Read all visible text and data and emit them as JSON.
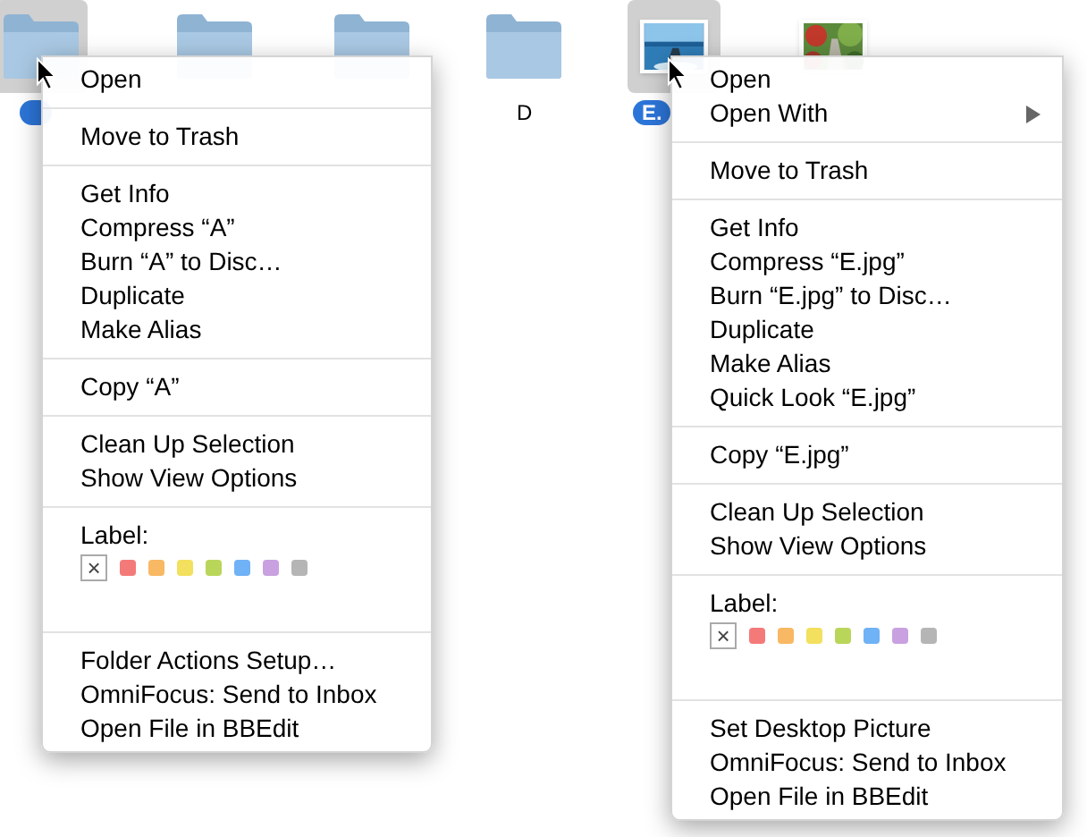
{
  "icons": [
    {
      "kind": "folder",
      "selected": true
    },
    {
      "kind": "folder",
      "selected": false
    },
    {
      "kind": "folder",
      "selected": false
    },
    {
      "kind": "folder",
      "selected": false,
      "label": "D"
    },
    {
      "kind": "picture",
      "selected": true,
      "label": "E."
    },
    {
      "kind": "picture",
      "selected": false
    }
  ],
  "menus": [
    {
      "sections": [
        [
          {
            "kind": "item",
            "text": "Open"
          }
        ],
        [
          {
            "kind": "item",
            "text": "Move to Trash"
          }
        ],
        [
          {
            "kind": "item",
            "text": "Get Info"
          },
          {
            "kind": "item",
            "text": "Compress “A”"
          },
          {
            "kind": "item",
            "text": "Burn “A” to Disc…"
          },
          {
            "kind": "item",
            "text": "Duplicate"
          },
          {
            "kind": "item",
            "text": "Make Alias"
          }
        ],
        [
          {
            "kind": "item",
            "text": "Copy “A”"
          }
        ],
        [
          {
            "kind": "item",
            "text": "Clean Up Selection"
          },
          {
            "kind": "item",
            "text": "Show View Options"
          }
        ],
        [
          {
            "kind": "labels",
            "text": "Label:",
            "none": "×",
            "colors": [
              {
                "color": "#f47a79"
              },
              {
                "color": "#f9b863"
              },
              {
                "color": "#f2e05e"
              },
              {
                "color": "#b9d65a"
              },
              {
                "color": "#6fb2f5"
              },
              {
                "color": "#c9a1e0"
              },
              {
                "color": "#b5b5b5"
              }
            ]
          }
        ],
        [
          {
            "kind": "item",
            "text": "Folder Actions Setup…"
          },
          {
            "kind": "item",
            "text": "OmniFocus: Send to Inbox"
          },
          {
            "kind": "item",
            "text": "Open File in BBEdit"
          }
        ]
      ]
    },
    {
      "sections": [
        [
          {
            "kind": "item",
            "text": "Open"
          },
          {
            "kind": "submenu",
            "text": "Open With"
          }
        ],
        [
          {
            "kind": "item",
            "text": "Move to Trash"
          }
        ],
        [
          {
            "kind": "item",
            "text": "Get Info"
          },
          {
            "kind": "item",
            "text": "Compress “E.jpg”"
          },
          {
            "kind": "item",
            "text": "Burn “E.jpg” to Disc…"
          },
          {
            "kind": "item",
            "text": "Duplicate"
          },
          {
            "kind": "item",
            "text": "Make Alias"
          },
          {
            "kind": "item",
            "text": "Quick Look “E.jpg”"
          }
        ],
        [
          {
            "kind": "item",
            "text": "Copy “E.jpg”"
          }
        ],
        [
          {
            "kind": "item",
            "text": "Clean Up Selection"
          },
          {
            "kind": "item",
            "text": "Show View Options"
          }
        ],
        [
          {
            "kind": "labels",
            "text": "Label:",
            "none": "×",
            "colors": [
              {
                "color": "#f47a79"
              },
              {
                "color": "#f9b863"
              },
              {
                "color": "#f2e05e"
              },
              {
                "color": "#b9d65a"
              },
              {
                "color": "#6fb2f5"
              },
              {
                "color": "#c9a1e0"
              },
              {
                "color": "#b5b5b5"
              }
            ]
          }
        ],
        [
          {
            "kind": "item",
            "text": "Set Desktop Picture"
          },
          {
            "kind": "item",
            "text": "OmniFocus: Send to Inbox"
          },
          {
            "kind": "item",
            "text": "Open File in BBEdit"
          }
        ]
      ]
    }
  ]
}
